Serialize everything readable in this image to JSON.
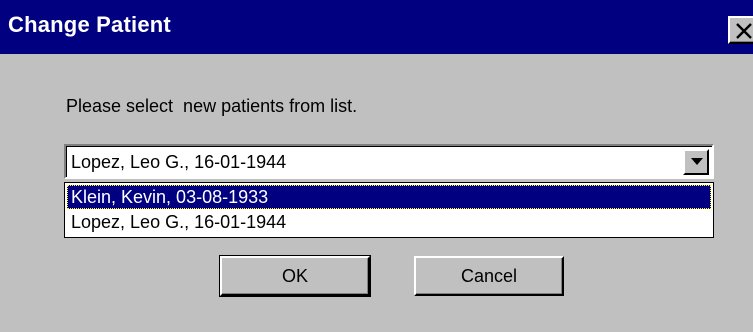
{
  "window": {
    "title": "Change Patient",
    "close_icon": "close-icon"
  },
  "dialog": {
    "prompt": "Please select  new patients from list.",
    "combo_value": "Lopez, Leo G., 16-01-1944",
    "options": [
      {
        "label": "Klein, Kevin, 03-08-1933",
        "selected": true
      },
      {
        "label": "Lopez, Leo G., 16-01-1944",
        "selected": false
      }
    ],
    "ok_label": "OK",
    "cancel_label": "Cancel"
  },
  "colors": {
    "title_bar": "#000080",
    "face": "#c0c0c0",
    "selection": "#000080"
  }
}
